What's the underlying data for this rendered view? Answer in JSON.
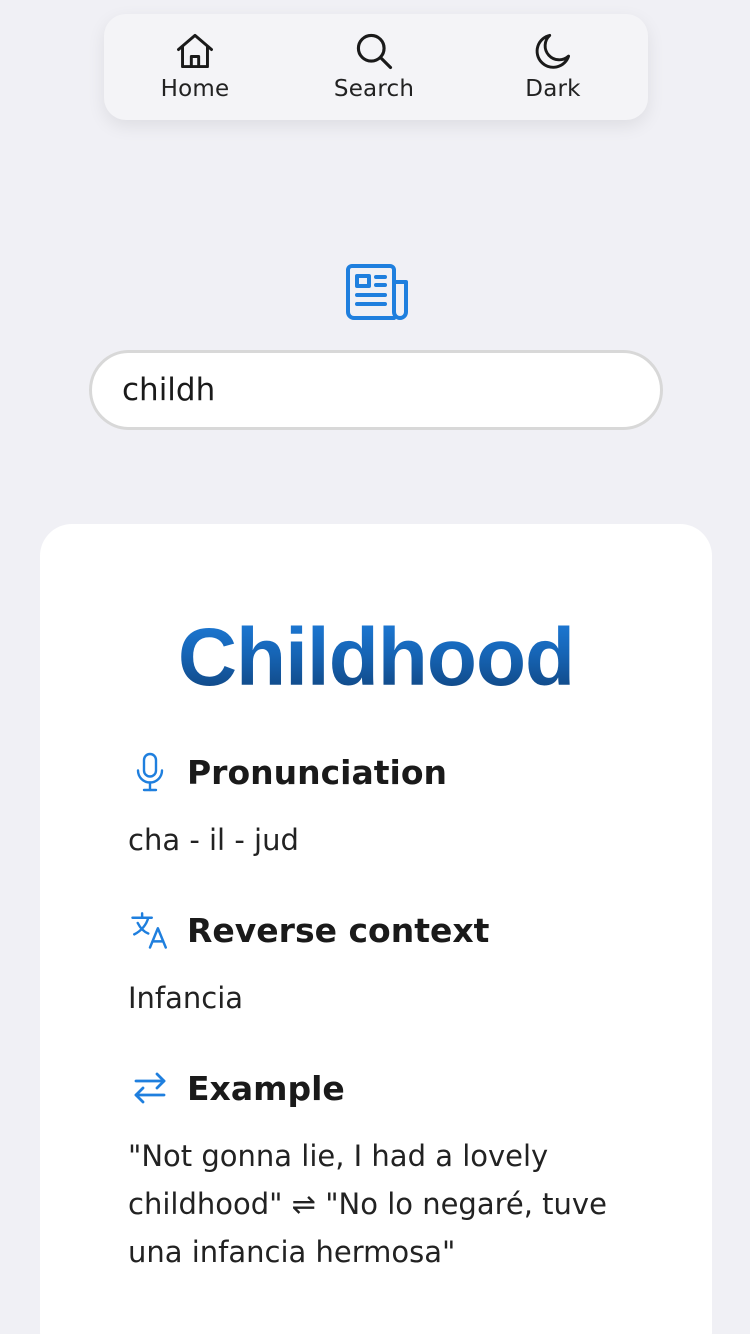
{
  "nav": {
    "items": [
      {
        "label": "Home",
        "icon": "home-icon"
      },
      {
        "label": "Search",
        "icon": "search-icon"
      },
      {
        "label": "Dark",
        "icon": "moon-icon"
      }
    ]
  },
  "header_icon": "newspaper-icon",
  "search": {
    "value": "childh",
    "placeholder": ""
  },
  "result": {
    "word": "Childhood",
    "pronunciation": {
      "title": "Pronunciation",
      "icon": "microphone-icon",
      "text": "cha - il - jud"
    },
    "reverse": {
      "title": "Reverse context",
      "icon": "translate-icon",
      "text": "Infancia"
    },
    "example": {
      "title": "Example",
      "icon": "swap-arrows-icon",
      "text": "\"Not gonna lie, I had a lovely childhood\" ⇌ \"No lo negaré, tuve una infancia hermosa\""
    }
  },
  "colors": {
    "accent": "#1f7fde",
    "accent_dark": "#0f3d72",
    "background": "#f0f0f5",
    "card": "#ffffff"
  }
}
